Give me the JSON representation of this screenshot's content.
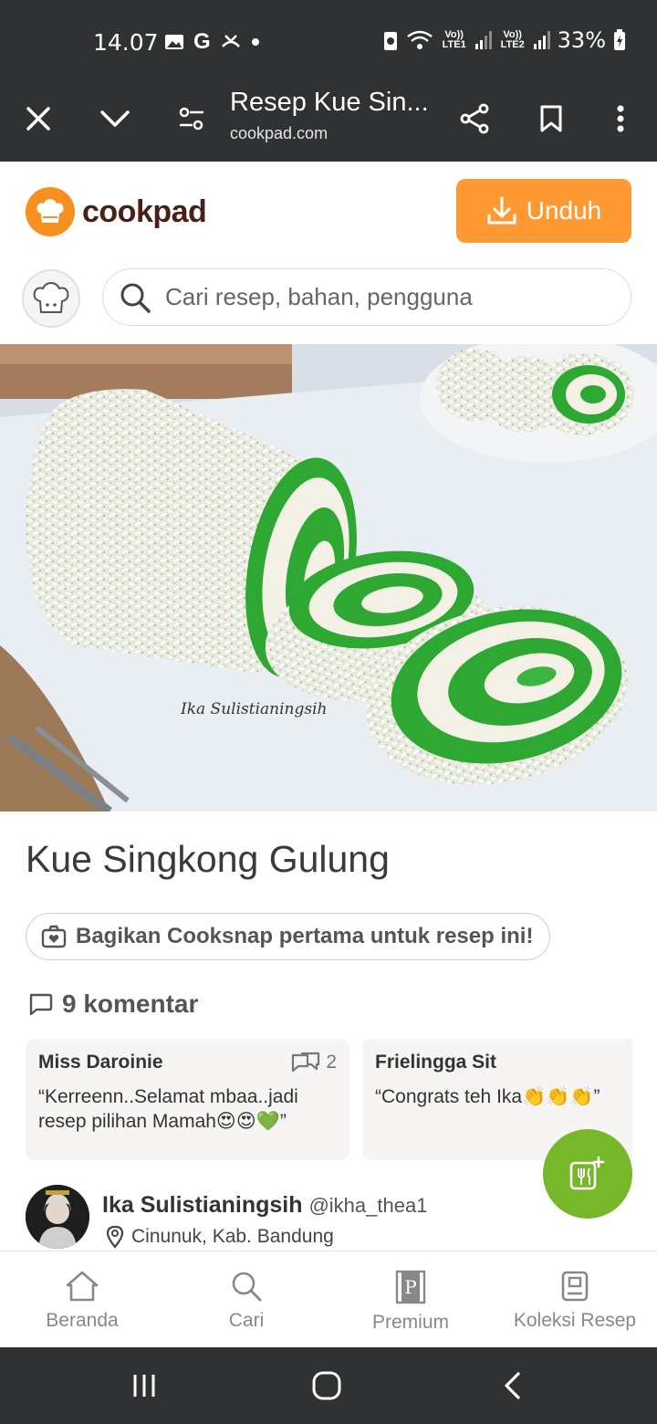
{
  "status_bar": {
    "time": "14.07",
    "g_icon": "G",
    "signal1_label": "Vo)) LTE1",
    "signal2_label": "Vo)) LTE2",
    "battery": "33%"
  },
  "browser": {
    "title": "Resep Kue Sin...",
    "url": "cookpad.com"
  },
  "header": {
    "logo_text": "cookpad",
    "download_label": "Unduh",
    "brand_color": "#ff9933"
  },
  "search": {
    "placeholder": "Cari resep, bahan, pengguna"
  },
  "hero": {
    "watermark": "Ika Sulistianingsih"
  },
  "recipe": {
    "title": "Kue Singkong Gulung",
    "cooksnap_label": "Bagikan Cooksnap pertama untuk resep ini!",
    "comments_label": "9 komentar"
  },
  "comments": [
    {
      "name": "Miss Daroinie",
      "replies": "2",
      "text": "“Kerreenn..Selamat mbaa..jadi resep pilihan Mamah😍😍💚”"
    },
    {
      "name": "Frielingga Sit",
      "replies": "",
      "text": "“Congrats teh Ika👏👏👏”"
    }
  ],
  "author": {
    "name": "Ika Sulistianingsih",
    "handle": "@ikha_thea1",
    "location": "Cinunuk, Kab. Bandung"
  },
  "bottom_nav": {
    "home": "Beranda",
    "search": "Cari",
    "premium": "Premium",
    "collection": "Koleksi Resep"
  },
  "colors": {
    "fab": "#76b82a",
    "bars": "#2f3133"
  }
}
